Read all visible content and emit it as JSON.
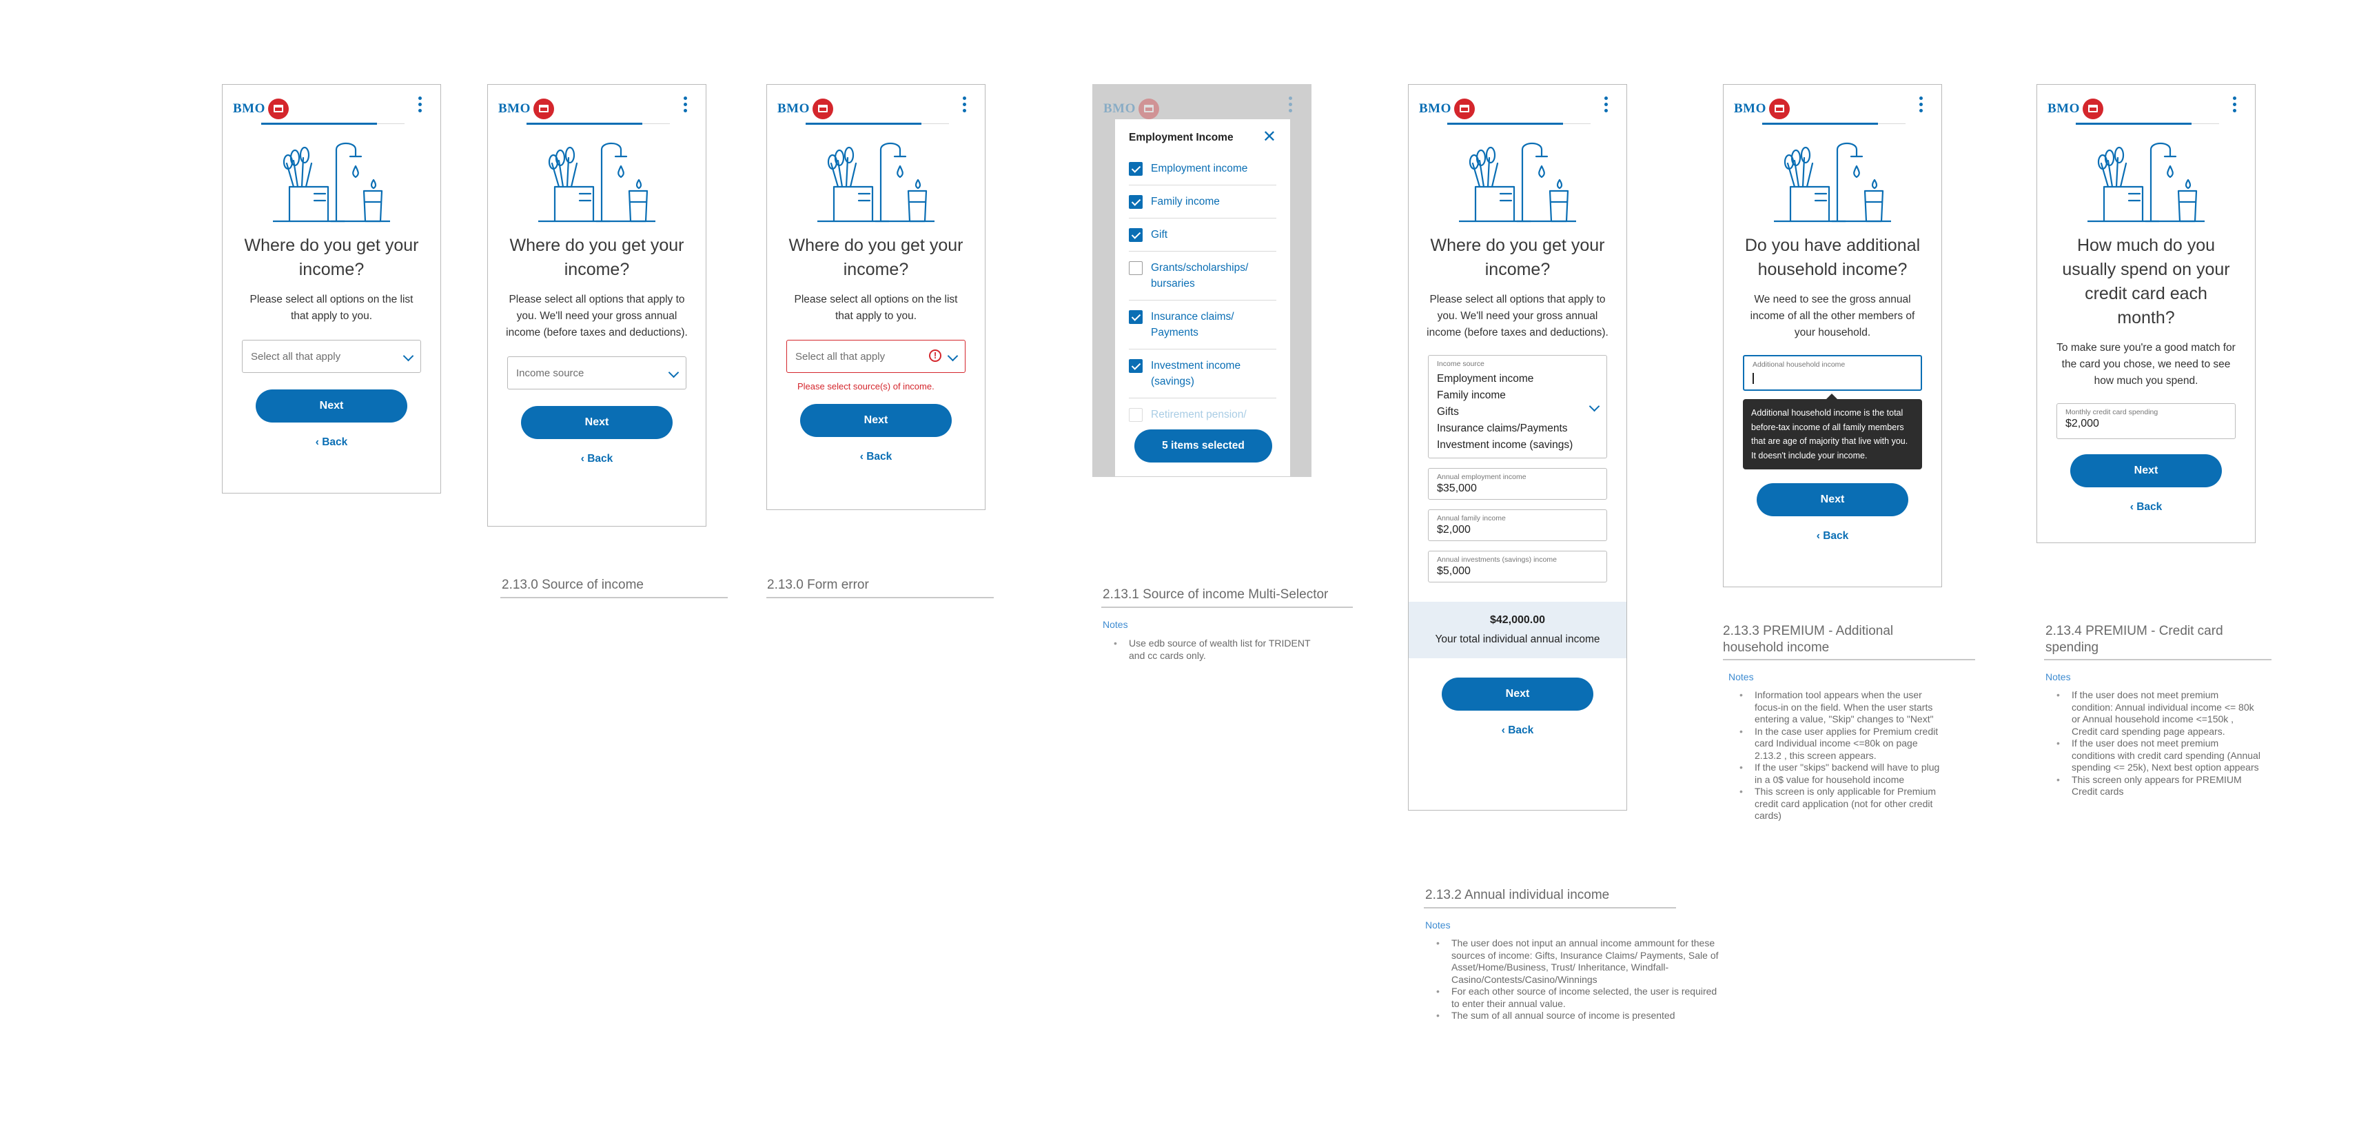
{
  "brand": {
    "logo_text": "BMO",
    "primary": "#0a6eb4",
    "red": "#d4262c",
    "error": "#d4262c"
  },
  "s1": {
    "title": "Where do you get your income?",
    "desc": "Please select all options on the list that apply to you.",
    "select_placeholder": "Select all that apply",
    "next": "Next",
    "back": "Back"
  },
  "s2": {
    "title": "Where do you get your income?",
    "desc": "Please select all options that apply to you. We'll need your gross annual income (before taxes and deductions).",
    "select_placeholder": "Income source",
    "next": "Next",
    "back": "Back",
    "caption": "2.13.0 Source of income"
  },
  "s3": {
    "title": "Where do you get your income?",
    "desc": "Please select all options on the list that apply to you.",
    "select_placeholder": "Select all that apply",
    "error": "Please select source(s) of income.",
    "next": "Next",
    "back": "Back",
    "caption": "2.13.0 Form error"
  },
  "s4": {
    "modal_title": "Employment Income",
    "items": [
      {
        "label": "Employment income",
        "checked": true
      },
      {
        "label": "Family income",
        "checked": true
      },
      {
        "label": "Gift",
        "checked": true
      },
      {
        "label": "Grants/scholarships/ bursaries",
        "checked": false
      },
      {
        "label": "Insurance claims/ Payments",
        "checked": true
      },
      {
        "label": "Investment income (savings)",
        "checked": true
      },
      {
        "label": "Retirement pension/",
        "checked": false
      }
    ],
    "selected_button": "5 items selected",
    "caption": "2.13.1 Source of income Multi-Selector",
    "notes_title": "Notes",
    "notes": [
      "Use edb source of wealth list for TRIDENT and cc cards only."
    ]
  },
  "s5": {
    "title": "Where do you get your income?",
    "desc": "Please select all options that apply to you. We'll need your gross annual income (before taxes and deductions).",
    "source_label": "Income source",
    "sources": [
      "Employment income",
      "Family income",
      "Gifts",
      "Insurance claims/Payments",
      "Investment income (savings)"
    ],
    "fields": [
      {
        "label": "Annual employment income",
        "value": "$35,000"
      },
      {
        "label": "Annual family income",
        "value": "$2,000"
      },
      {
        "label": "Annual investments (savings) income",
        "value": "$5,000"
      }
    ],
    "total_value": "$42,000.00",
    "total_label": "Your total individual annual income",
    "next": "Next",
    "back": "Back",
    "caption": "2.13.2 Annual individual income",
    "notes_title": "Notes",
    "notes": [
      "The user does not input an annual income ammount for these sources of income: Gifts, Insurance Claims/ Payments, Sale of Asset/Home/Business, Trust/ Inheritance, Windfall-Casino/Contests/Casino/Winnings",
      "For each other source of income selected, the user is required to enter their annual value.",
      "The sum of all annual source of income is presented"
    ]
  },
  "s6": {
    "title": "Do you have additional household income?",
    "desc": "We need to see the gross annual income of all the other members of your household.",
    "field_label": "Additional household income",
    "tooltip": "Additional household income is the total before-tax income of all family members that are age of majority that live with you. It doesn't include your income.",
    "next": "Next",
    "back": "Back",
    "caption": "2.13.3 PREMIUM - Additional household income",
    "notes_title": "Notes",
    "notes": [
      "Information tool appears when the user focus-in on the field. When the user starts entering a value, \"Skip\" changes to \"Next\"",
      "In the case user applies for Premium credit card Individual income <=80k on page 2.13.2 , this screen appears.",
      "If the user \"skips\" backend will have to plug in a 0$ value for household income",
      "This screen is only applicable for Premium credit card application (not for other credit cards)"
    ]
  },
  "s7": {
    "title": "How much do you usually spend on your credit card each month?",
    "desc": "To make sure you're a good match for the card you chose, we need to see how much you spend.",
    "field_label": "Monthly credit card spending",
    "field_value": "$2,000",
    "next": "Next",
    "back": "Back",
    "caption": "2.13.4 PREMIUM - Credit card spending",
    "notes_title": "Notes",
    "notes": [
      "If the user does not meet premium condition: Annual individual income <= 80k or Annual household income <=150k , Credit card spending page appears.",
      "If the user does not meet premium conditions with credit card spending (Annual spending <= 25k), Next best option appears",
      "This screen only appears for PREMIUM Credit cards"
    ]
  }
}
